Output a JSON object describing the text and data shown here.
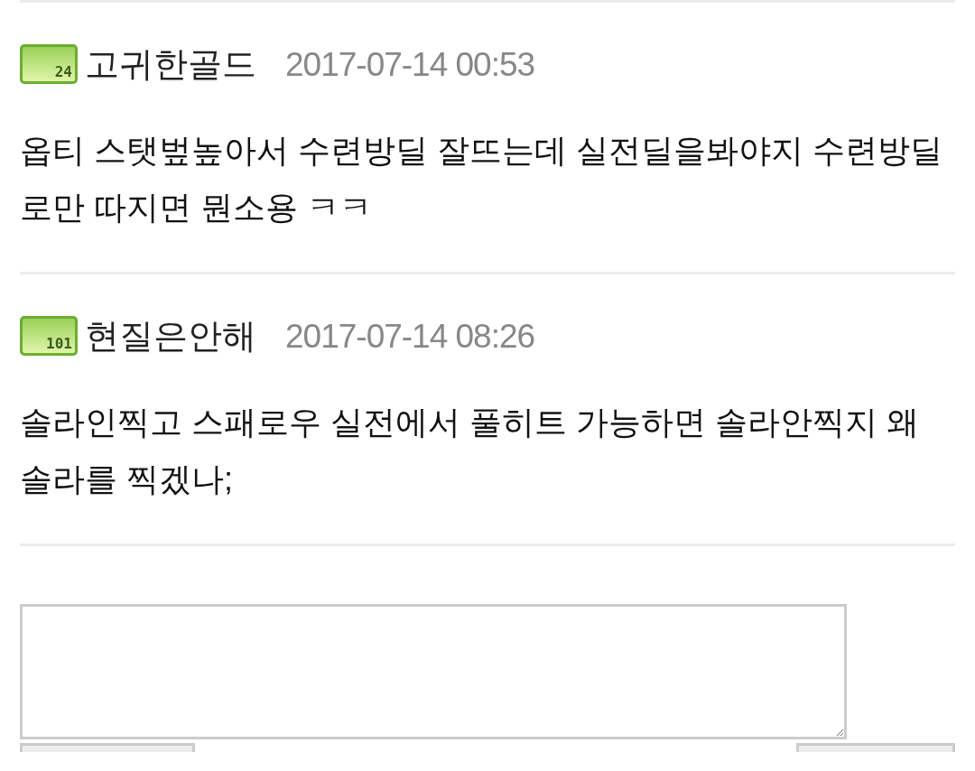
{
  "comments": [
    {
      "level_badge": "24",
      "author": "고귀한골드",
      "time": "2017-07-14 00:53",
      "text": "옵티 스탯벞높아서 수련방딜 잘뜨는데 실전딜을봐야지 수련방딜로만 따지면 뭔소용 ㅋㅋ"
    },
    {
      "level_badge": "101",
      "author": "현질은안해",
      "time": "2017-07-14 08:26",
      "text": "솔라인찍고 스패로우 실전에서 풀히트 가능하면 솔라안찍지 왜 솔라를 찍겠나;"
    }
  ]
}
